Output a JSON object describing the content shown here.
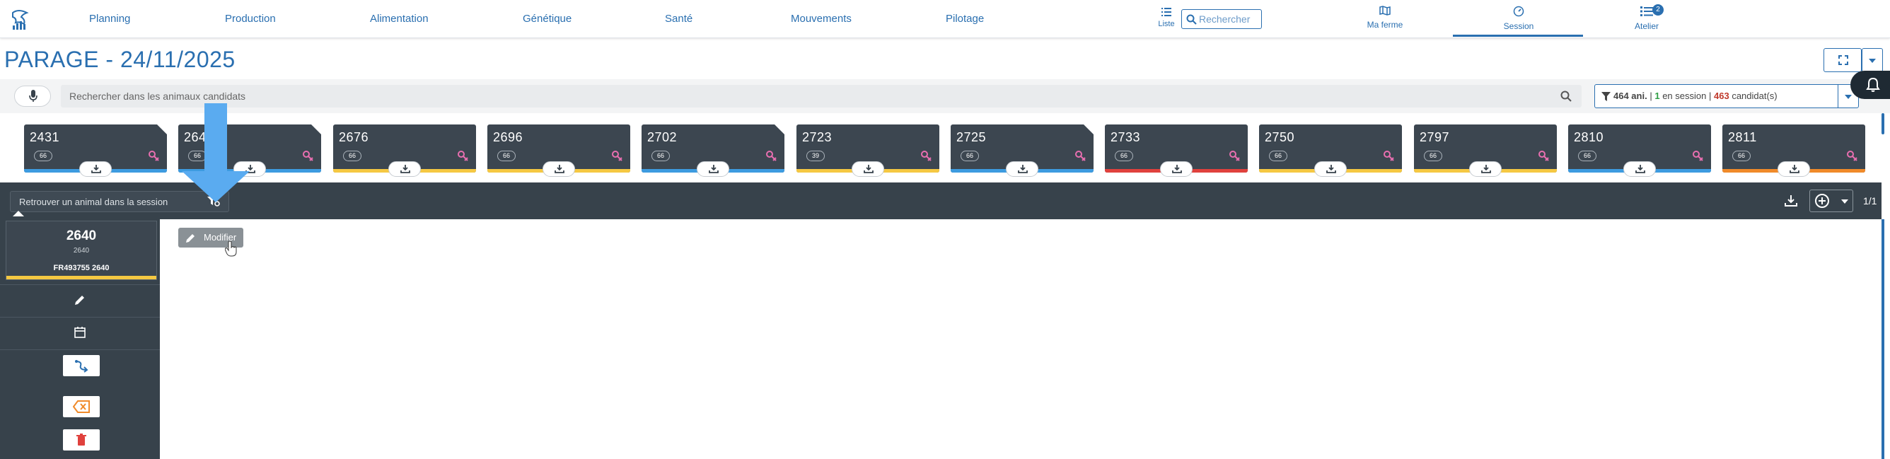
{
  "nav": {
    "items": [
      "Planning",
      "Production",
      "Alimentation",
      "Génétique",
      "Santé",
      "Mouvements",
      "Pilotage"
    ],
    "liste_label": "Liste",
    "search_placeholder": "Rechercher",
    "ma_ferme_label": "Ma ferme",
    "session_label": "Session",
    "atelier_label": "Atelier",
    "atelier_badge": "2"
  },
  "page": {
    "title": "PARAGE - 24/11/2025"
  },
  "search": {
    "placeholder": "Rechercher dans les animaux candidats"
  },
  "filter": {
    "animals": "464 ani.",
    "sep1": "|",
    "in_session_count": "1",
    "in_session_label": "en session",
    "sep2": "|",
    "candidates_count": "463",
    "candidates_label": "candidat(s)"
  },
  "cards": [
    {
      "num": "2431",
      "chip": "66",
      "bar": "#3d9be0",
      "corner": true
    },
    {
      "num": "2640",
      "chip": "66",
      "bar": "#3d9be0",
      "corner": true
    },
    {
      "num": "2676",
      "chip": "66",
      "bar": "#f5c842",
      "corner": false
    },
    {
      "num": "2696",
      "chip": "66",
      "bar": "#f5c842",
      "corner": false
    },
    {
      "num": "2702",
      "chip": "66",
      "bar": "#3d9be0",
      "corner": true
    },
    {
      "num": "2723",
      "chip": "39",
      "bar": "#f5c842",
      "corner": false
    },
    {
      "num": "2725",
      "chip": "66",
      "bar": "#3d9be0",
      "corner": true
    },
    {
      "num": "2733",
      "chip": "66",
      "bar": "#e0413d",
      "corner": false
    },
    {
      "num": "2750",
      "chip": "66",
      "bar": "#f5c842",
      "corner": false
    },
    {
      "num": "2797",
      "chip": "66",
      "bar": "#f5c842",
      "corner": false
    },
    {
      "num": "2810",
      "chip": "66",
      "bar": "#3d9be0",
      "corner": false
    },
    {
      "num": "2811",
      "chip": "66",
      "bar": "#f08a2a",
      "corner": false
    }
  ],
  "session": {
    "search_placeholder": "Retrouver un animal dans la session",
    "pagination": "1/1"
  },
  "animal": {
    "number": "2640",
    "sub": "2640",
    "tag": "FR493755  2640"
  },
  "modify": {
    "label": "Modifier"
  },
  "colors": {
    "accent": "#2a6fb0",
    "dark": "#37424b",
    "arrow": "#5aabf0",
    "female_symbol": "#e86fb0",
    "orange_btn": "#f08a2a",
    "delete": "#e0413d",
    "green": "#2f9e44",
    "red_count": "#c0392b"
  }
}
